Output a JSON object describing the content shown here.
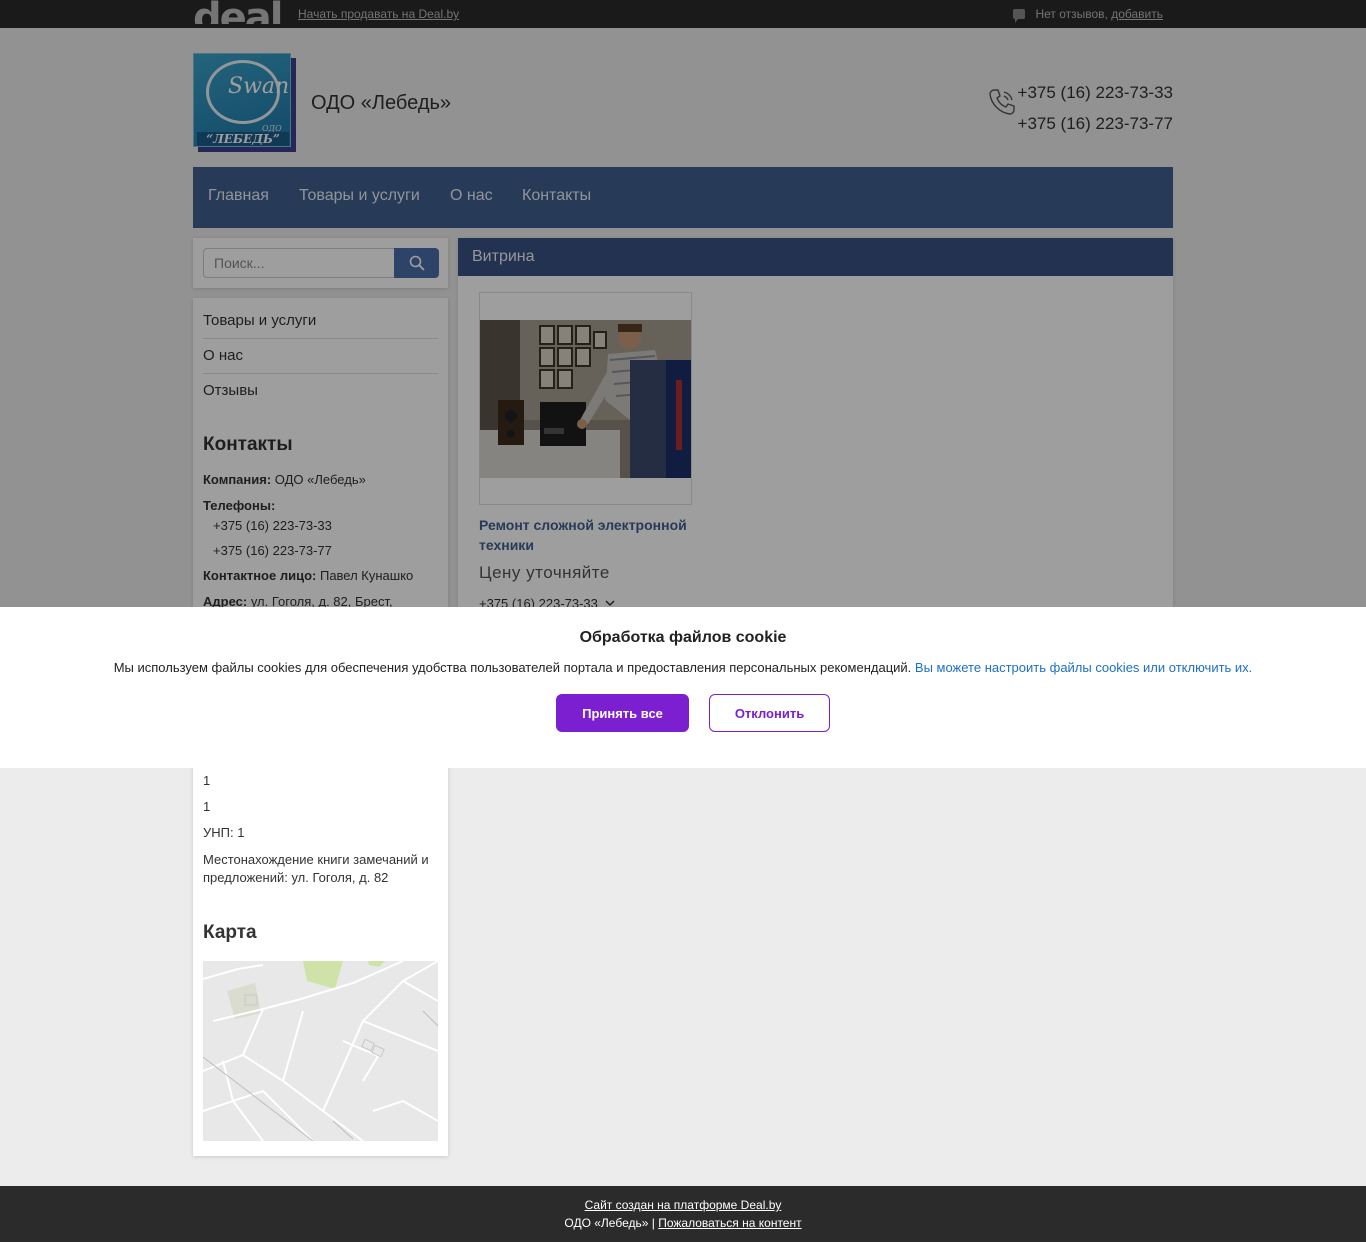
{
  "topbar": {
    "logo_text": "deal",
    "sell_link": "Начать продавать на Deal.by",
    "reviews_text": "Нет отзывов,",
    "reviews_add": "добавить"
  },
  "header": {
    "company_name": "ОДО «Лебедь»",
    "logo_script": "Swan",
    "logo_odo": "ОДО",
    "logo_label": "“ЛЕБЕДЬ”",
    "phones": [
      "+375 (16) 223-73-33",
      "+375 (16) 223-73-77"
    ]
  },
  "nav": {
    "items": [
      "Главная",
      "Товары и услуги",
      "О нас",
      "Контакты"
    ]
  },
  "search": {
    "placeholder": "Поиск..."
  },
  "sidebar": {
    "menu": [
      "Товары и услуги",
      "О нас",
      "Отзывы"
    ],
    "contacts_title": "Контакты",
    "company_label": "Компания:",
    "company_value": "ОДО «Лебедь»",
    "phones_label": "Телефоны:",
    "phones": [
      "+375 (16) 223-73-33",
      "+375 (16) 223-73-77"
    ],
    "contact_label": "Контактное лицо:",
    "contact_value": "Павел Кунашко",
    "address_label": "Адрес:",
    "address_value": "ул. Гоголя, д. 82, Брест,",
    "line_1": "1",
    "line_2": "1",
    "unp": "УНП: 1",
    "complaints": "Местонахождение книги замечаний и предложений: ул. Гоголя, д. 82",
    "map_title": "Карта"
  },
  "showcase": {
    "title": "Витрина",
    "product": {
      "name": "Ремонт сложной электронной техники",
      "price": "Цену уточняйте",
      "phone": "+375 (16) 223-73-33"
    }
  },
  "cookie": {
    "title": "Обработка файлов cookie",
    "text": "Мы используем файлы cookies для обеспечения удобства пользователей портала и предоставления персональных рекомендаций.",
    "link": "Вы можете настроить файлы cookies или отключить их.",
    "accept": "Принять все",
    "decline": "Отклонить"
  },
  "footer": {
    "platform_link": "Сайт создан на платформе Deal.by",
    "company": "ОДО «Лебедь» |",
    "complain_link": "Пожаловаться на контент"
  },
  "colors": {
    "nav_bg": "#3f5f8f",
    "showcase_header": "#3a5285",
    "accept_button": "#7b1fd1",
    "link_blue": "#1c6fc8"
  }
}
